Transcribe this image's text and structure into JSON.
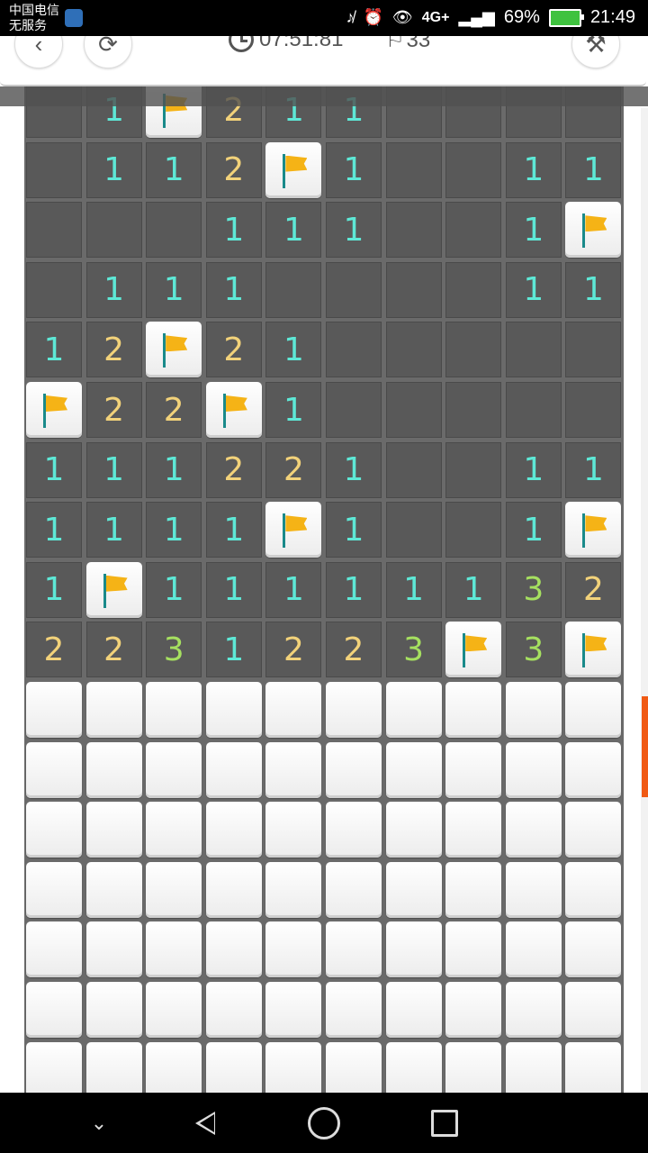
{
  "status_bar": {
    "carrier_line1": "中国电信",
    "carrier_line2": "无服务",
    "network": "4G+",
    "battery": "69%",
    "time": "21:49"
  },
  "toolbar": {
    "timer": "07:51:81",
    "flags": "33"
  },
  "colors": {
    "n1": "#5ee8d6",
    "n2": "#f2d27a",
    "n3": "#a6e060",
    "accent": "#f05a14"
  },
  "board": {
    "columns": 10,
    "visible_rows": 17,
    "rows": [
      [
        "o",
        "1",
        "F",
        "2",
        "1",
        "1",
        "o",
        "o",
        "o",
        "o"
      ],
      [
        "o",
        "1",
        "1",
        "2",
        "F",
        "1",
        "o",
        "o",
        "1",
        "1"
      ],
      [
        "o",
        "o",
        "o",
        "1",
        "1",
        "1",
        "o",
        "o",
        "1",
        "F"
      ],
      [
        "o",
        "1",
        "1",
        "1",
        "o",
        "o",
        "o",
        "o",
        "1",
        "1"
      ],
      [
        "1",
        "2",
        "F",
        "2",
        "1",
        "o",
        "o",
        "o",
        "o",
        "o"
      ],
      [
        "F",
        "2",
        "2",
        "F",
        "1",
        "o",
        "o",
        "o",
        "o",
        "o"
      ],
      [
        "1",
        "1",
        "1",
        "2",
        "2",
        "1",
        "o",
        "o",
        "1",
        "1"
      ],
      [
        "1",
        "1",
        "1",
        "1",
        "F",
        "1",
        "o",
        "o",
        "1",
        "F"
      ],
      [
        "1",
        "F",
        "1",
        "1",
        "1",
        "1",
        "1",
        "1",
        "3",
        "2"
      ],
      [
        "2",
        "2",
        "3",
        "1",
        "2",
        "2",
        "3",
        "F",
        "3",
        "F"
      ],
      [
        "c",
        "c",
        "c",
        "c",
        "c",
        "c",
        "c",
        "c",
        "c",
        "c"
      ],
      [
        "c",
        "c",
        "c",
        "c",
        "c",
        "c",
        "c",
        "c",
        "c",
        "c"
      ],
      [
        "c",
        "c",
        "c",
        "c",
        "c",
        "c",
        "c",
        "c",
        "c",
        "c"
      ],
      [
        "c",
        "c",
        "c",
        "c",
        "c",
        "c",
        "c",
        "c",
        "c",
        "c"
      ],
      [
        "c",
        "c",
        "c",
        "c",
        "c",
        "c",
        "c",
        "c",
        "c",
        "c"
      ],
      [
        "c",
        "c",
        "c",
        "c",
        "c",
        "c",
        "c",
        "c",
        "c",
        "c"
      ],
      [
        "c",
        "c",
        "c",
        "c",
        "c",
        "c",
        "c",
        "c",
        "c",
        "c"
      ]
    ]
  }
}
